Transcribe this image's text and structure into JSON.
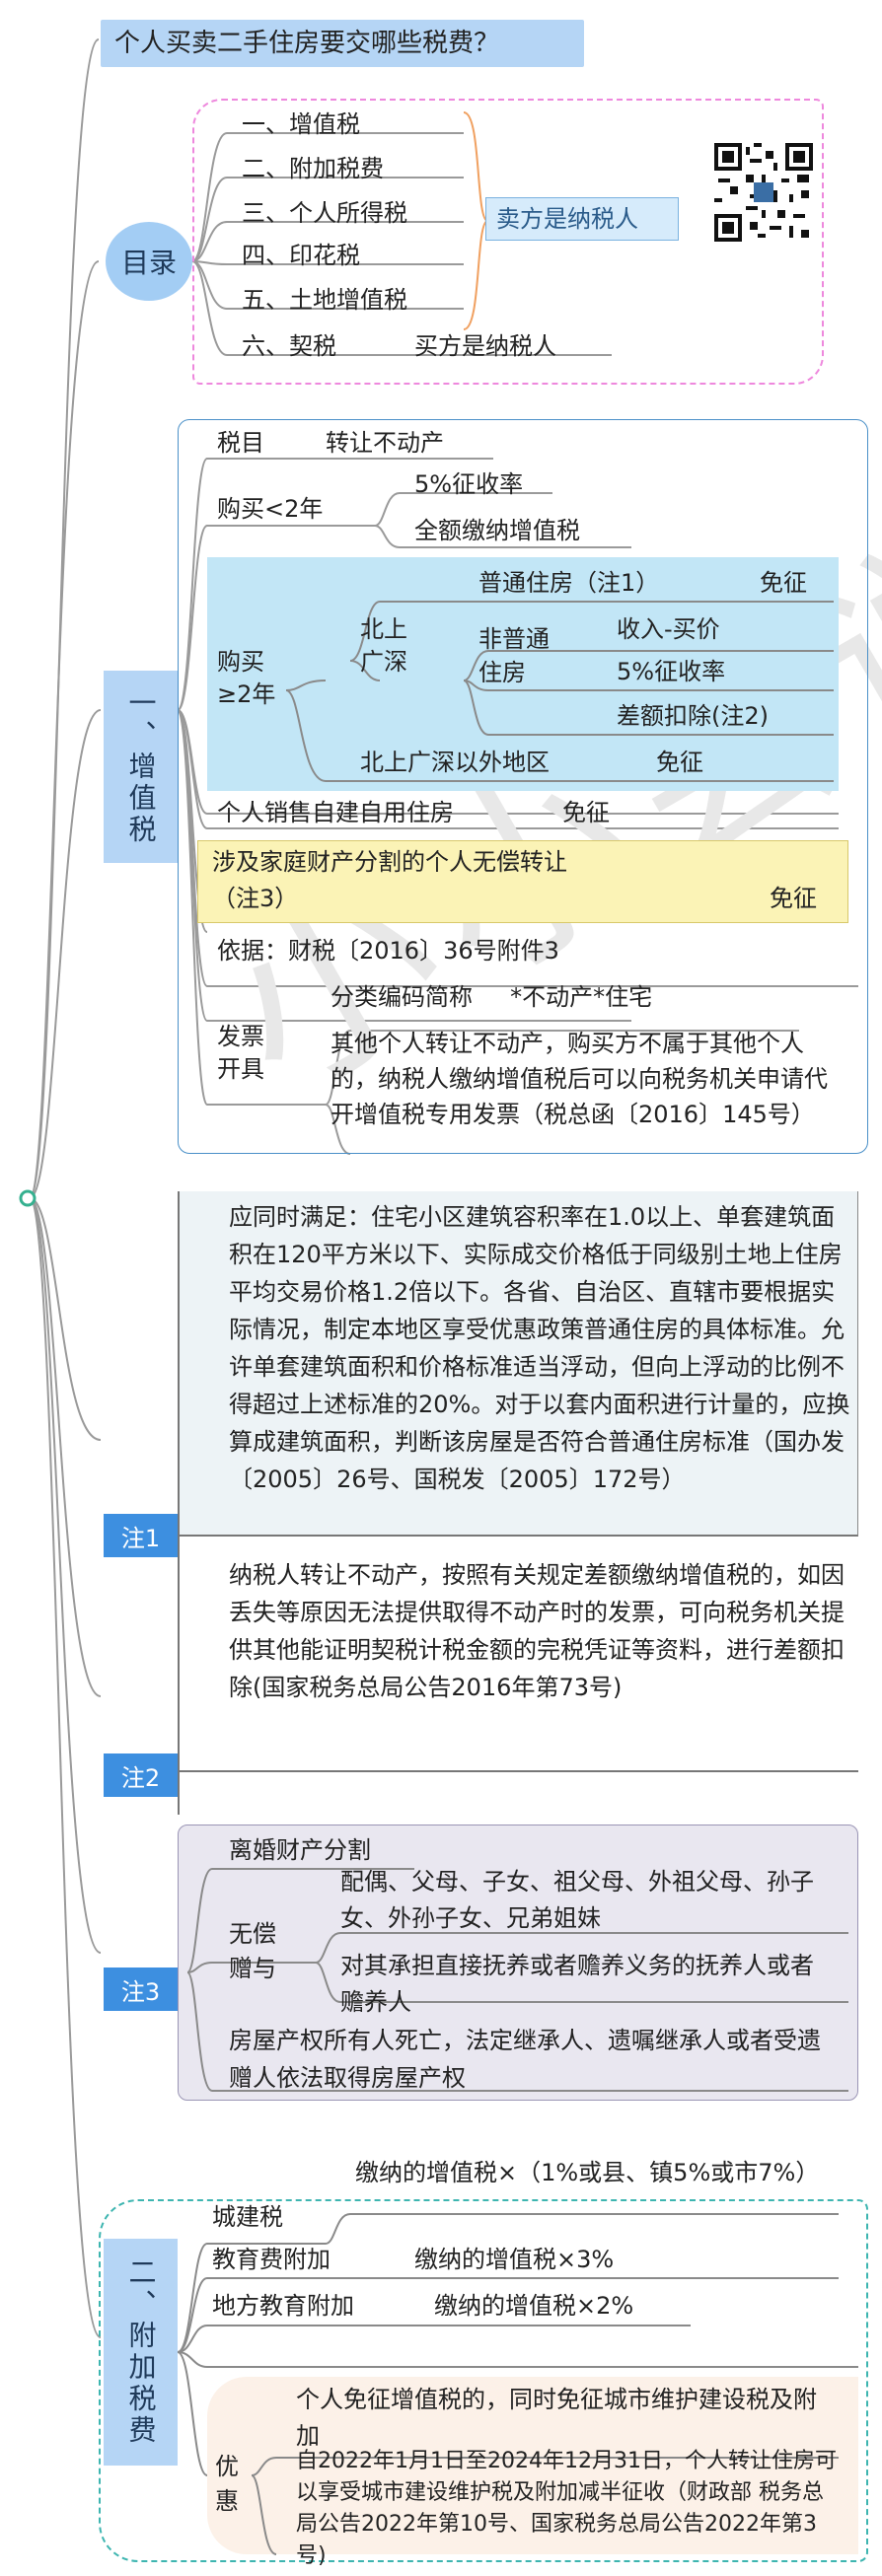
{
  "title": "个人买卖二手住房要交哪些税费？",
  "toc": {
    "label": "目录",
    "items": [
      "一、增值税",
      "二、附加税费",
      "三、个人所得税",
      "四、印花税",
      "五、土地增值税",
      "六、契税"
    ],
    "seller_label": "卖方是纳税人",
    "buyer_label": "买方是纳税人"
  },
  "vat": {
    "label": "一、增值税",
    "tax_item_key": "税目",
    "tax_item_value": "转让不动产",
    "lt2_label": "购买<2年",
    "lt2_a": "5%征收率",
    "lt2_b": "全额缴纳增值税",
    "ge2_label_1": "购买",
    "ge2_label_2": "≥2年",
    "bsgs_label_1": "北上",
    "bsgs_label_2": "广深",
    "ordinary": "普通住房（注1）",
    "ordinary_exempt": "免征",
    "nonordinary_1": "非普通",
    "nonordinary_2": "住房",
    "income_minus_price": "收入-买价",
    "rate5": "5%征收率",
    "diff_deduct": "差额扣除(注2)",
    "outside": "北上广深以外地区",
    "outside_exempt": "免征",
    "selfbuilt": "个人销售自建自用住房",
    "selfbuilt_exempt": "免征",
    "family_1": "涉及家庭财产分割的个人无偿转让",
    "family_2": "（注3）",
    "family_exempt": "免征",
    "basis": "依据：财税〔2016〕36号附件3",
    "invoice_label_1": "发票",
    "invoice_label_2": "开具",
    "invoice_code": "分类编码简称     *不动产*住宅",
    "invoice_text": "其他个人转让不动产，购买方不属于其他个人的，纳税人缴纳增值税后可以向税务机关申请代开增值税专用发票（税总函〔2016〕145号）"
  },
  "notes": {
    "n1_tag": "注1",
    "n1_text": "应同时满足：住宅小区建筑容积率在1.0以上、单套建筑面积在120平方米以下、实际成交价格低于同级别土地上住房平均交易价格1.2倍以下。各省、自治区、直辖市要根据实际情况，制定本地区享受优惠政策普通住房的具体标准。允许单套建筑面积和价格标准适当浮动，但向上浮动的比例不得超过上述标准的20%。对于以套内面积进行计量的，应换算成建筑面积，判断该房屋是否符合普通住房标准（国办发〔2005〕26号、国税发〔2005〕172号）",
    "n2_tag": "注2",
    "n2_text": "纳税人转让不动产，按照有关规定差额缴纳增值税的，如因丢失等原因无法提供取得不动产时的发票，可向税务机关提供其他能证明契税计税金额的完税凭证等资料，进行差额扣除(国家税务总局公告2016年第73号)",
    "n3_tag": "注3",
    "n3_divorce": "离婚财产分割",
    "n3_gift_1": "无偿",
    "n3_gift_2": "赠与",
    "n3_gift_a": "配偶、父母、子女、祖父母、外祖父母、孙子女、外孙子女、兄弟姐妹",
    "n3_gift_b": "对其承担直接抚养或者赡养义务的抚养人或者赡养人",
    "n3_inherit": "房屋产权所有人死亡，法定继承人、遗嘱继承人或者受遗赠人依法取得房屋产权"
  },
  "surtax": {
    "label": "二、附加税费",
    "city_label": "城建税",
    "city_value": "缴纳的增值税×（1%或县、镇5%或市7%）",
    "edu_label": "教育费附加",
    "edu_value": "缴纳的增值税×3%",
    "local_label": "地方教育附加",
    "local_value": "缴纳的增值税×2%",
    "pref_label_1": "优",
    "pref_label_2": "惠",
    "pref_a": "个人免征增值税的，同时免征城市维护建设税及附加",
    "pref_b": "自2022年1月1日至2024年12月31日，个人转让住房可以享受城市建设维护税及附加减半征收（财政部 税务总局公告2022年第10号、国家税务总局公告2022年第3号)"
  },
  "watermark": "小小会说"
}
